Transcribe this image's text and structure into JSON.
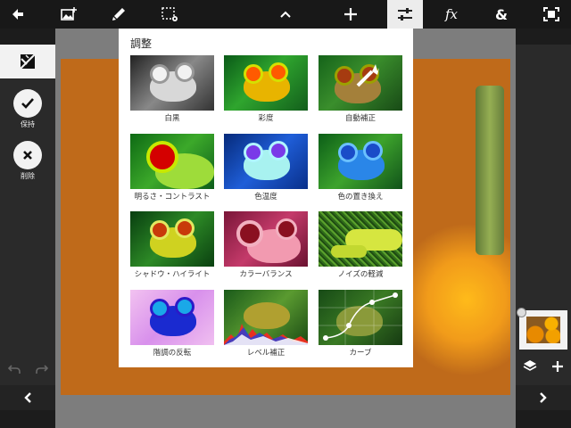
{
  "toolbar": {
    "buttons": [
      {
        "name": "back-arrow-icon",
        "active": false
      },
      {
        "name": "add-image-icon",
        "active": false
      },
      {
        "name": "brush-icon",
        "active": false
      },
      {
        "name": "selection-settings-icon",
        "active": false
      },
      {
        "name": "chevron-up-icon",
        "active": false
      },
      {
        "name": "move-icon",
        "active": false
      },
      {
        "name": "adjustments-sliders-icon",
        "active": true
      },
      {
        "name": "fx-icon",
        "active": false
      },
      {
        "name": "ampersand-icon",
        "active": false
      },
      {
        "name": "fullscreen-icon",
        "active": false
      }
    ],
    "fx_label": "fx",
    "amp_label": "&"
  },
  "left_panel": {
    "keep_label": "保持",
    "delete_label": "削除",
    "undo_icon": "undo-icon",
    "redo_icon": "redo-icon"
  },
  "popup": {
    "title": "調整",
    "items": [
      {
        "label": "白黒",
        "style": "bw"
      },
      {
        "label": "彩度",
        "style": "saturation"
      },
      {
        "label": "自動補正",
        "style": "auto"
      },
      {
        "label": "明るさ・コントラスト",
        "style": "brightness"
      },
      {
        "label": "色温度",
        "style": "temperature"
      },
      {
        "label": "色の置き換え",
        "style": "replace"
      },
      {
        "label": "シャドウ・ハイライト",
        "style": "shadow"
      },
      {
        "label": "カラーバランス",
        "style": "balance"
      },
      {
        "label": "ノイズの軽減",
        "style": "noise"
      },
      {
        "label": "階調の反転",
        "style": "invert"
      },
      {
        "label": "レベル補正",
        "style": "levels"
      },
      {
        "label": "カーブ",
        "style": "curves"
      }
    ]
  },
  "colors": {
    "toolbar_bg": "#181818",
    "panel_bg": "#2a2a2a",
    "popup_bg": "#ffffff"
  }
}
